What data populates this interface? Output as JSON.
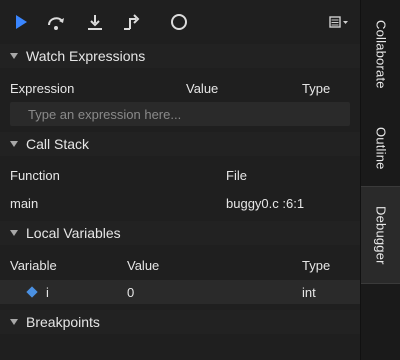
{
  "toolbar": {
    "icons": [
      {
        "name": "play-icon",
        "color": "#3a86ff"
      },
      {
        "name": "step-over-icon"
      },
      {
        "name": "step-into-icon"
      },
      {
        "name": "step-out-icon"
      },
      {
        "name": "stop-icon"
      },
      {
        "name": "menu-icon"
      }
    ]
  },
  "watch": {
    "title": "Watch Expressions",
    "headers": {
      "expression": "Expression",
      "value": "Value",
      "type": "Type"
    },
    "placeholder": "Type an expression here..."
  },
  "callstack": {
    "title": "Call Stack",
    "headers": {
      "function": "Function",
      "file": "File"
    },
    "rows": [
      {
        "function": "main",
        "file": "buggy0.c :6:1"
      }
    ]
  },
  "locals": {
    "title": "Local Variables",
    "headers": {
      "variable": "Variable",
      "value": "Value",
      "type": "Type"
    },
    "rows": [
      {
        "variable": "i",
        "value": "0",
        "type": "int"
      }
    ]
  },
  "breakpoints": {
    "title": "Breakpoints"
  },
  "right_tabs": [
    "Collaborate",
    "Outline",
    "Debugger"
  ],
  "colors": {
    "accent": "#3a86ff",
    "diamond": "#4a90e2",
    "background": "#1f1f1f"
  }
}
